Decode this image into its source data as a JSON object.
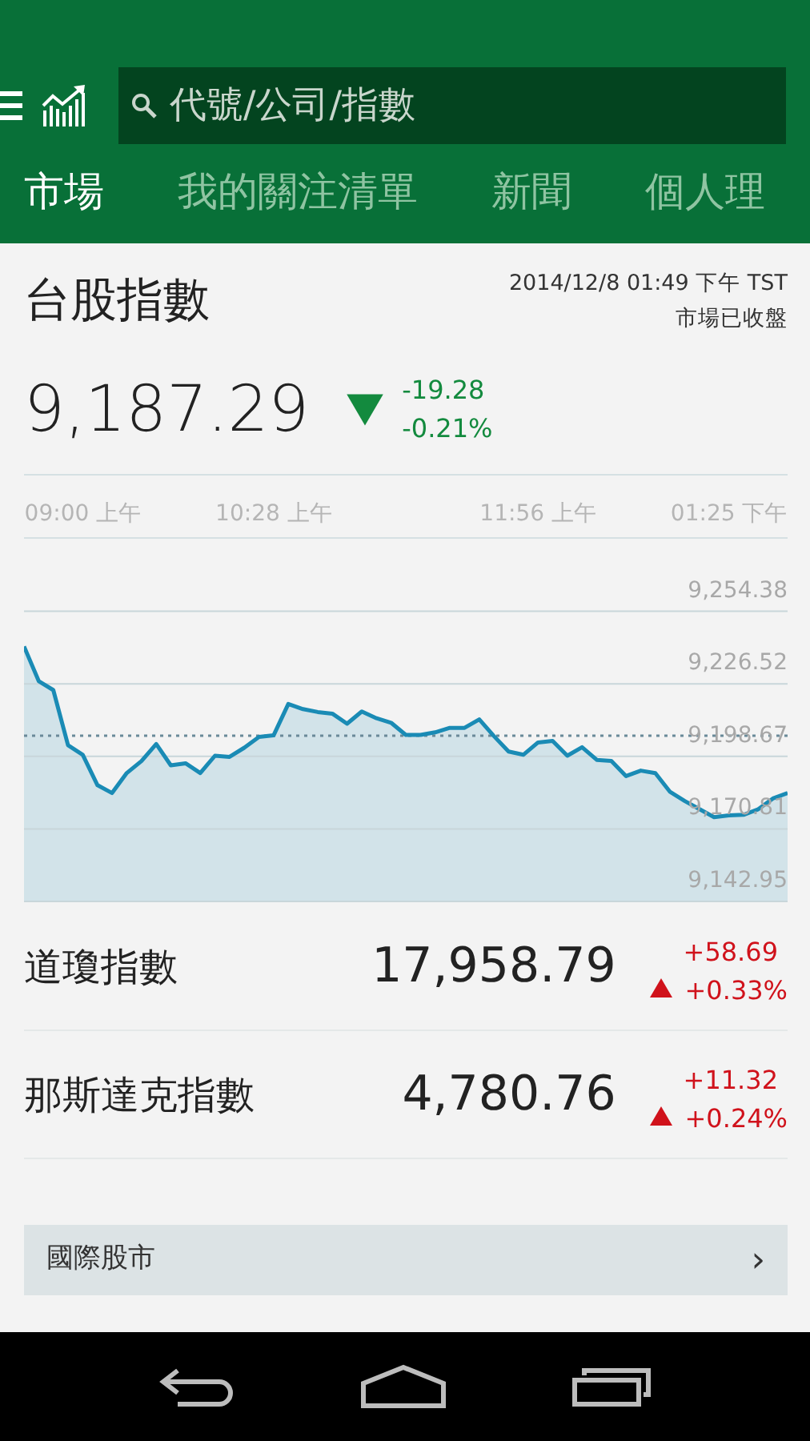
{
  "header": {
    "search": {
      "placeholder": "代號/公司/指數"
    }
  },
  "tabs": [
    {
      "label": "市場",
      "selected": true
    },
    {
      "label": "我的關注清單",
      "selected": false
    },
    {
      "label": "新聞",
      "selected": false
    },
    {
      "label": "個人理",
      "selected": false
    }
  ],
  "main_index": {
    "name": "台股指數",
    "timestamp": "2014/12/8 01:49 下午 TST",
    "market_status": "市場已收盤",
    "value": "9,187.29",
    "kind": "fall",
    "change": "-19.28",
    "change_percent": "-0.21%",
    "chart_data": {
      "type": "area",
      "categories": [
        null,
        null,
        null,
        null,
        "09:00 上午",
        null,
        null,
        null,
        null,
        null,
        null,
        null,
        null,
        null,
        null,
        null,
        null,
        "10:28 上午",
        null,
        null,
        null,
        null,
        null,
        null,
        null,
        null,
        null,
        null,
        null,
        null,
        null,
        null,
        null,
        null,
        null,
        "11:56 上午",
        null,
        null,
        null,
        null,
        null,
        null,
        null,
        null,
        null,
        null,
        null,
        null,
        "01:25 下午",
        null,
        null,
        null,
        null
      ],
      "series": [
        {
          "color": "#1a8bb5",
          "values": [
            9240.9,
            9227.6,
            9224.1,
            9203.0,
            9199.3,
            9187.6,
            9184.6,
            9192.3,
            9196.9,
            9203.4,
            9195.2,
            9196.0,
            9192.3,
            9198.9,
            9198.5,
            9202.0,
            9206.1,
            9206.7,
            9218.8,
            9216.8,
            9215.7,
            9215.1,
            9211.2,
            9215.9,
            9213.3,
            9211.6,
            9206.9,
            9206.9,
            9207.9,
            9209.6,
            9209.6,
            9212.9,
            9206.5,
            9200.5,
            9199.3,
            9204.0,
            9204.6,
            9198.9,
            9202.2,
            9197.3,
            9196.9,
            9191.1,
            9193.2,
            9192.2,
            9185.0,
            9181.5,
            9178.4,
            9175.3,
            9176.0,
            9176.2,
            9178.4,
            9182.5,
            9184.6
          ]
        }
      ],
      "ylim": [
        9142.95,
        9282.55
      ],
      "grid": true,
      "yticks": [
        {
          "value": 9254.38,
          "label": "9,254.38"
        },
        {
          "value": 9226.52,
          "label": "9,226.52"
        },
        {
          "value": 9198.67,
          "label": "9,198.67"
        },
        {
          "value": 9170.81,
          "label": "9,170.81"
        },
        {
          "value": 9142.95,
          "label": "9,142.95"
        }
      ],
      "ref_lines": [
        {
          "axis": "y",
          "value": 9206.57
        }
      ]
    }
  },
  "indices": [
    {
      "name": "道瓊指數",
      "value": "17,958.79",
      "kind": "rise",
      "change": "+58.69",
      "change_percent": "+0.33%"
    },
    {
      "name": "那斯達克指數",
      "value": "4,780.76",
      "kind": "rise",
      "change": "+11.32",
      "change_percent": "+0.24%"
    }
  ],
  "link": {
    "label": "國際股市",
    "chevron": "›"
  }
}
